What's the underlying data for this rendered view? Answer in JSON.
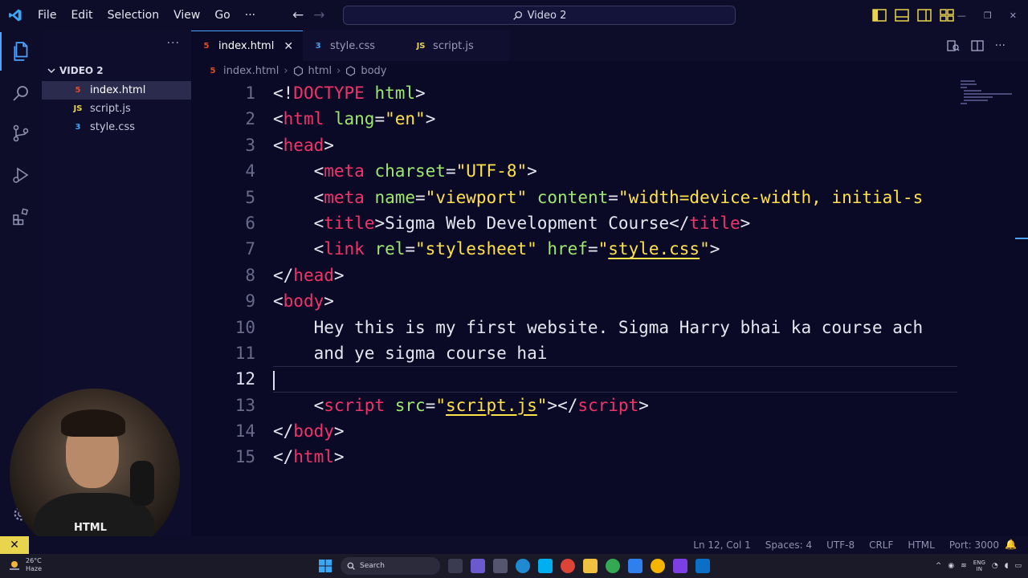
{
  "titlebar": {
    "menu": [
      "File",
      "Edit",
      "Selection",
      "View",
      "Go"
    ],
    "more": "···",
    "back_arrow": "←",
    "forward_arrow": "→",
    "search_text": "Video 2",
    "window_controls": [
      "—",
      "❐",
      "✕"
    ]
  },
  "sidebar": {
    "more": "···",
    "folder": "VIDEO 2",
    "files": [
      {
        "icon": "5",
        "name": "index.html"
      },
      {
        "icon": "JS",
        "name": "script.js"
      },
      {
        "icon": "3",
        "name": "style.css"
      }
    ]
  },
  "tabs": [
    {
      "icon": "5",
      "label": "index.html",
      "close": "✕"
    },
    {
      "icon": "3",
      "label": "style.css"
    },
    {
      "icon": "JS",
      "label": "script.js"
    }
  ],
  "breadcrumb": {
    "file_icon": "5",
    "file": "index.html",
    "sep1": "›",
    "element1": "html",
    "sep2": "›",
    "element2": "body"
  },
  "editor": {
    "line_numbers": [
      "1",
      "2",
      "3",
      "4",
      "5",
      "6",
      "7",
      "8",
      "9",
      "10",
      "11",
      "12",
      "13",
      "14",
      "15"
    ],
    "current_line": 12,
    "tokens": {
      "l1": [
        "<!",
        "DOCTYPE",
        " html",
        ">"
      ],
      "l2": [
        "<",
        "html",
        " lang",
        "=",
        "\"en\"",
        ">"
      ],
      "l3": [
        "<",
        "head",
        ">"
      ],
      "l4": [
        "    <",
        "meta",
        " charset",
        "=",
        "\"UTF-8\"",
        ">"
      ],
      "l5": [
        "    <",
        "meta",
        " name",
        "=",
        "\"viewport\"",
        " content",
        "=",
        "\"width=device-width, initial-s"
      ],
      "l6": [
        "    <",
        "title",
        ">Sigma Web Development Course</",
        "title",
        ">"
      ],
      "l7": [
        "    <",
        "link",
        " rel",
        "=",
        "\"stylesheet\"",
        " href",
        "=",
        "\"",
        "style.css",
        "\"",
        ">"
      ],
      "l8": [
        "</",
        "head",
        ">"
      ],
      "l9": [
        "<",
        "body",
        ">"
      ],
      "l10": [
        "    Hey this is my first website. Sigma Harry bhai ka course ach"
      ],
      "l11": [
        "    and ye sigma course hai"
      ],
      "l12": [
        ""
      ],
      "l13": [
        "    <",
        "script",
        " src",
        "=",
        "\"",
        "script.js",
        "\"",
        "></",
        "script",
        ">"
      ],
      "l14": [
        "</",
        "body",
        ">"
      ],
      "l15": [
        "</",
        "html",
        ">"
      ]
    }
  },
  "webcam": {
    "shirt_text": "HTML"
  },
  "statusbar": {
    "remote_icon": "✕",
    "position": "Ln 12, Col 1",
    "spaces": "Spaces: 4",
    "encoding": "UTF-8",
    "eol": "CRLF",
    "language": "HTML",
    "port": "Port: 3000",
    "bell": "🔔"
  },
  "taskbar": {
    "temp": "26°C",
    "condition": "Haze",
    "search_label": "Search",
    "lang_line1": "ENG",
    "lang_line2": "IN"
  },
  "colors": {
    "background": "#0b0a26",
    "tag": "#f0346a",
    "attribute": "#9fe870",
    "string": "#ffe14a",
    "accent": "#4fa3ff"
  }
}
